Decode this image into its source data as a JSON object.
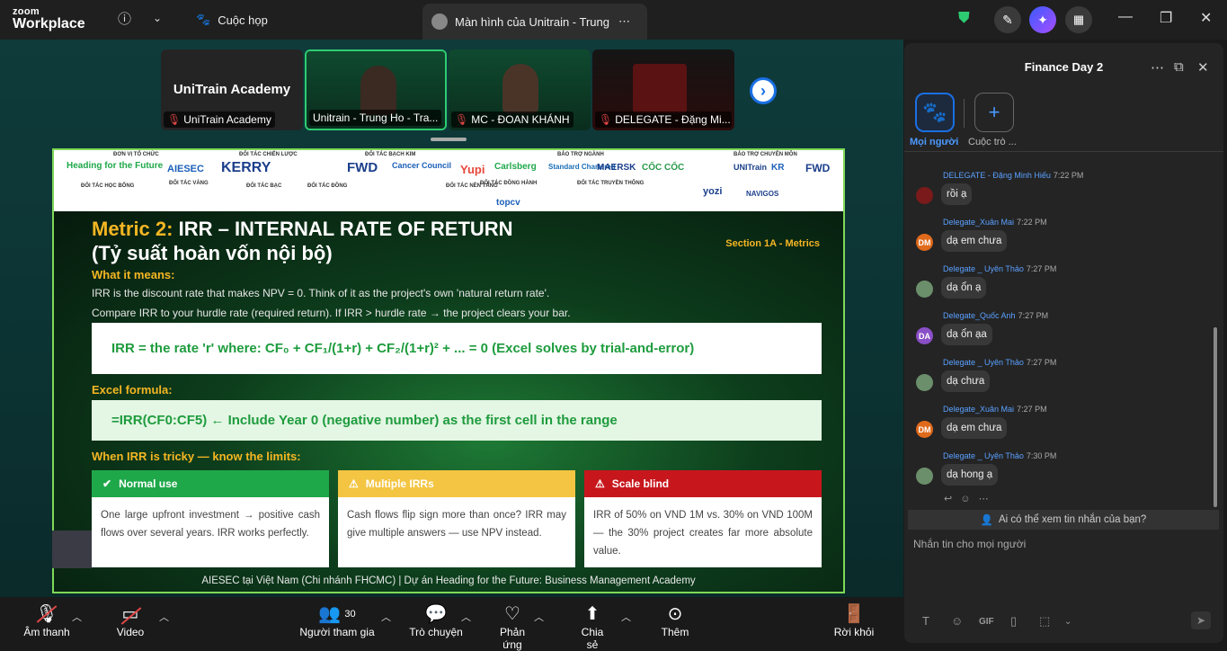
{
  "app": {
    "logo_top": "zoom",
    "logo_bottom": "Workplace"
  },
  "tabs": [
    {
      "label": "Cuộc họp"
    },
    {
      "label": "Màn hình của Unitrain - Trung Ho"
    }
  ],
  "thumbnails": [
    {
      "big": "UniTrain Academy",
      "name": "UniTrain Academy"
    },
    {
      "name": "Unitrain - Trung Ho - Tra..."
    },
    {
      "name": "MC - ĐOAN KHÁNH"
    },
    {
      "name": "DELEGATE - Đặng Mi..."
    }
  ],
  "slide": {
    "sponsors": {
      "organizer": "ĐƠN VỊ TỔ CHỨC",
      "strategic": "ĐỐI TÁC CHIẾN LƯỢC",
      "platinum": "ĐỐI TÁC BẠCH KIM",
      "industry": "BẢO TRỢ NGÀNH",
      "expert": "BẢO TRỢ CHUYÊN MÔN",
      "academic": "ĐỐI TÁC HỌC BỔNG",
      "gold": "ĐỐI TÁC VÀNG",
      "silver": "ĐỐI TÁC BẠC",
      "bronze": "ĐỐI TÁC ĐỒNG",
      "companion": "ĐỐI TÁC ĐỒNG HÀNH",
      "platform": "ĐỐI TÁC NỀN TẢNG",
      "media": "ĐỐI TÁC TRUYỀN THÔNG",
      "logos": [
        "Heading for the Future",
        "AIESEC",
        "KERRY",
        "FWD",
        "Cancer Council",
        "Yupi",
        "Carlsberg",
        "Standard Chartered",
        "MAERSK",
        "CỐC CỐC",
        "UNITrain",
        "KR",
        "FWD",
        "yozi",
        "NAVIGOS",
        "topcv"
      ]
    },
    "title_metric": "Metric 2:",
    "title_rest": " IRR – INTERNAL RATE OF RETURN",
    "title_line2": "(Tỷ suất hoàn vốn nội bộ)",
    "section": "Section 1A - Metrics",
    "what_it_means": "What it means:",
    "para1": "IRR is the discount rate that makes NPV = 0. Think of it as the project's own 'natural return rate'.",
    "para2": "Compare IRR to your hurdle rate (required return). If IRR > hurdle rate → the project clears your bar.",
    "formula": "IRR = the rate 'r' where:    CF₀  +  CF₁/(1+r)  +  CF₂/(1+r)²  +  ...  = 0     (Excel solves by trial-and-error)",
    "excel_label": "Excel formula:",
    "excel": "=IRR(CF0:CF5)     ← Include Year 0 (negative number) as the first cell in the range",
    "tricky": "When IRR is tricky — know the limits:",
    "cards": [
      {
        "icon": "✔",
        "title": "Normal use",
        "body": "One large upfront investment → positive cash flows over several years. IRR works perfectly.",
        "color": "#1fa84a"
      },
      {
        "icon": "⚠",
        "title": "Multiple IRRs",
        "body": "Cash flows flip sign more than once? IRR may give multiple answers — use NPV instead.",
        "color": "#f4c542"
      },
      {
        "icon": "⚠",
        "title": "Scale blind",
        "body": "IRR of 50% on VND 1M vs. 30% on VND 100M — the 30% project creates far more absolute value.",
        "color": "#c8161d"
      }
    ],
    "footer": "AIESEC tại Việt Nam (Chi nhánh FHCMC) | Dự án Heading for the Future: Business Management Academy"
  },
  "toolbar": {
    "audio": "Âm thanh",
    "video": "Video",
    "participants": "Người tham gia",
    "participants_count": "30",
    "chat": "Trò chuyện",
    "reactions": "Phản ứng",
    "share": "Chia sẻ",
    "more": "Thêm",
    "leave": "Rời khỏi"
  },
  "panel": {
    "title": "Finance Day 2",
    "channels": [
      {
        "label": "Mọi người"
      },
      {
        "label": "Cuộc trò ..."
      }
    ],
    "messages": [
      {
        "sender": "DELEGATE - Đặng Minh Hiếu",
        "time": "7:22 PM",
        "text": "rồi ạ",
        "avatar": "",
        "avcolor": "#7a1a1a"
      },
      {
        "sender": "Delegate_Xuân Mai",
        "time": "7:22 PM",
        "text": "dạ em chưa",
        "avatar": "DM",
        "avcolor": "#e06a1b"
      },
      {
        "sender": "Delegate _ Uyên Thảo",
        "time": "7:27 PM",
        "text": "dạ ổn ạ",
        "avatar": "",
        "avcolor": "#6b8f6b"
      },
      {
        "sender": "Delegate_Quốc Anh",
        "time": "7:27 PM",
        "text": "dạ ổn ạa",
        "avatar": "DA",
        "avcolor": "#8a4fc7"
      },
      {
        "sender": "Delegate _ Uyên Thảo",
        "time": "7:27 PM",
        "text": "dạ chưa",
        "avatar": "",
        "avcolor": "#6b8f6b"
      },
      {
        "sender": "Delegate_Xuân Mai",
        "time": "7:27 PM",
        "text": "dạ em chưa",
        "avatar": "DM",
        "avcolor": "#e06a1b"
      },
      {
        "sender": "Delegate _ Uyên Thảo",
        "time": "7:30 PM",
        "text": "dạ hong ạ",
        "avatar": "",
        "avcolor": "#6b8f6b"
      }
    ],
    "who_can_see": "Ai có thể xem tin nhắn của bạn?",
    "compose_placeholder": "Nhắn tin cho mọi người",
    "gif": "GIF"
  }
}
